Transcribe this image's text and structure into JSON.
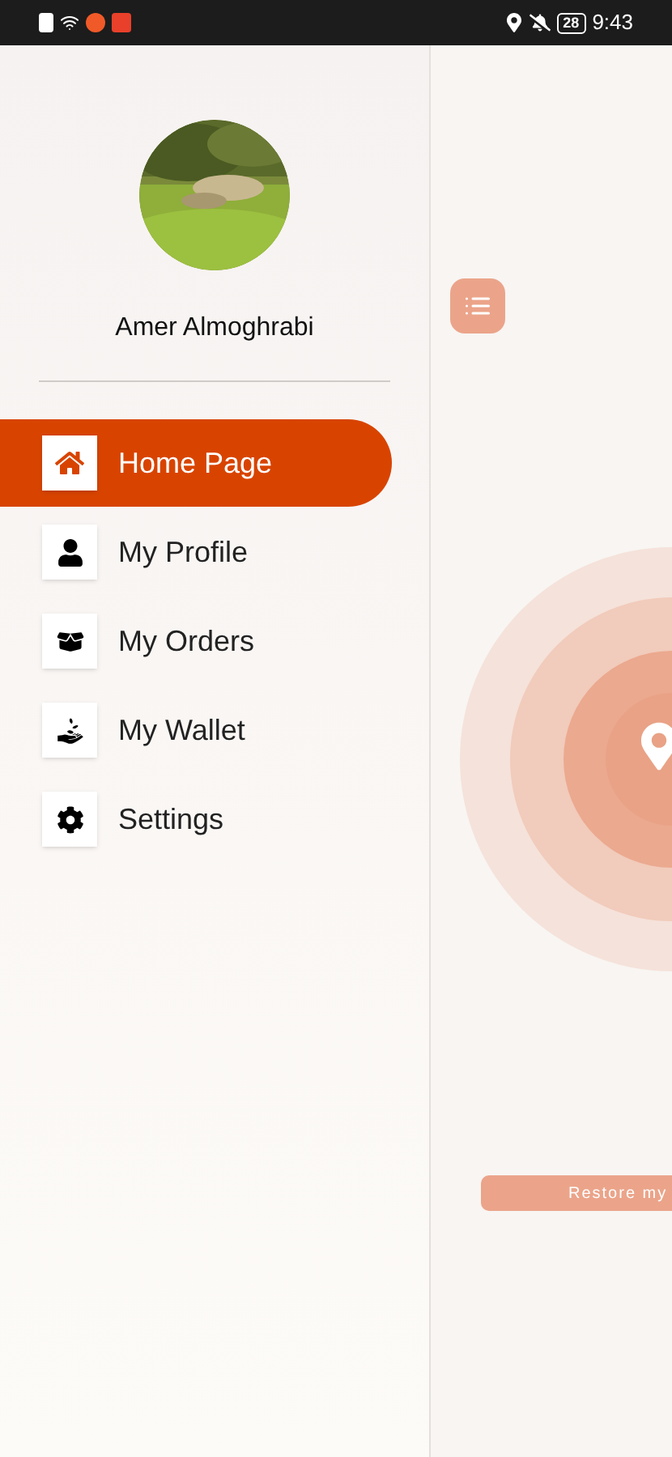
{
  "status_bar": {
    "battery": "28",
    "time": "9:43"
  },
  "drawer": {
    "user_name": "Amer Almoghrabi",
    "items": [
      {
        "label": "Home Page",
        "selected": true
      },
      {
        "label": "My Profile",
        "selected": false
      },
      {
        "label": "My Orders",
        "selected": false
      },
      {
        "label": "My Wallet",
        "selected": false
      },
      {
        "label": "Settings",
        "selected": false
      }
    ]
  },
  "main": {
    "button": "Restore my"
  }
}
